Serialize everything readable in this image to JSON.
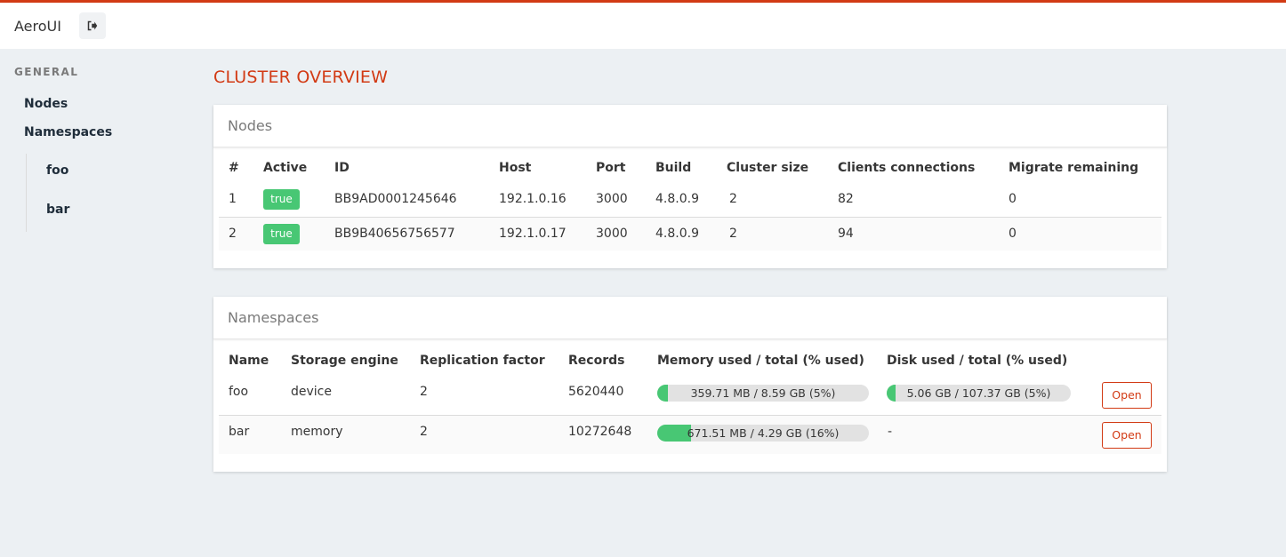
{
  "app": {
    "title": "AeroUI",
    "logout_icon": "sign-out-icon"
  },
  "colors": {
    "accent": "#d23a14",
    "success": "#48c774",
    "background": "#ecf0f3"
  },
  "sidebar": {
    "label": "GENERAL",
    "items": [
      {
        "label": "Nodes"
      },
      {
        "label": "Namespaces",
        "children": [
          {
            "label": "foo"
          },
          {
            "label": "bar"
          }
        ]
      }
    ]
  },
  "main": {
    "title": "CLUSTER OVERVIEW"
  },
  "nodes": {
    "title": "Nodes",
    "columns": [
      "#",
      "Active",
      "ID",
      "Host",
      "Port",
      "Build",
      "Cluster size",
      "Clients connections",
      "Migrate remaining"
    ],
    "rows": [
      {
        "index": "1",
        "active": "true",
        "id": "BB9AD0001245646",
        "host": "192.1.0.16",
        "port": "3000",
        "build": "4.8.0.9",
        "cluster_size": "2",
        "clients": "82",
        "migrate": "0"
      },
      {
        "index": "2",
        "active": "true",
        "id": "BB9B40656756577",
        "host": "192.1.0.17",
        "port": "3000",
        "build": "4.8.0.9",
        "cluster_size": "2",
        "clients": "94",
        "migrate": "0"
      }
    ]
  },
  "namespaces": {
    "title": "Namespaces",
    "columns": [
      "Name",
      "Storage engine",
      "Replication factor",
      "Records",
      "Memory used / total (% used)",
      "Disk used / total (% used)"
    ],
    "open_label": "Open",
    "rows": [
      {
        "name": "foo",
        "engine": "device",
        "replication": "2",
        "records": "5620440",
        "memory_text": "359.71 MB / 8.59 GB (5%)",
        "memory_pct": 5,
        "disk_text": "5.06 GB / 107.37 GB (5%)",
        "disk_pct": 5
      },
      {
        "name": "bar",
        "engine": "memory",
        "replication": "2",
        "records": "10272648",
        "memory_text": "671.51 MB / 4.29 GB (16%)",
        "memory_pct": 16,
        "disk_text": "-"
      }
    ]
  }
}
